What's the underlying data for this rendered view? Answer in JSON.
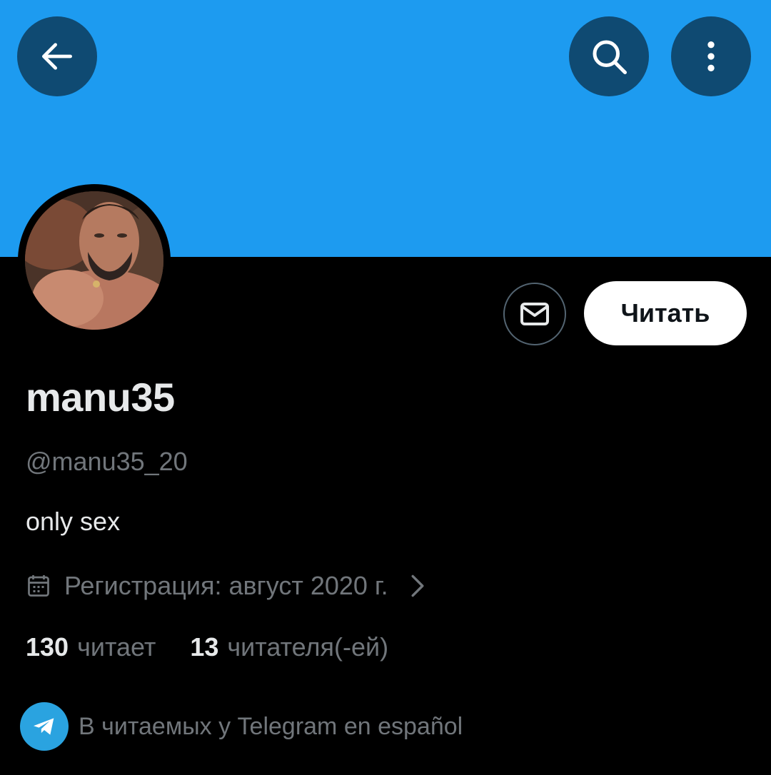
{
  "header": {
    "back_icon": "arrow-left-icon",
    "search_icon": "search-icon",
    "more_icon": "more-vertical-icon",
    "banner_color": "#1d9bf0"
  },
  "profile": {
    "display_name": "manu35",
    "handle": "@manu35_20",
    "bio": "only sex",
    "joined": "Регистрация: август 2020 г.",
    "follow_label": "Читать",
    "message_icon": "envelope-icon"
  },
  "stats": {
    "following_count": "130",
    "following_label": "читает",
    "followers_count": "13",
    "followers_label": "читателя(-ей)"
  },
  "followed_by": {
    "icon": "telegram-icon",
    "text": "В читаемых у Telegram en español"
  }
}
